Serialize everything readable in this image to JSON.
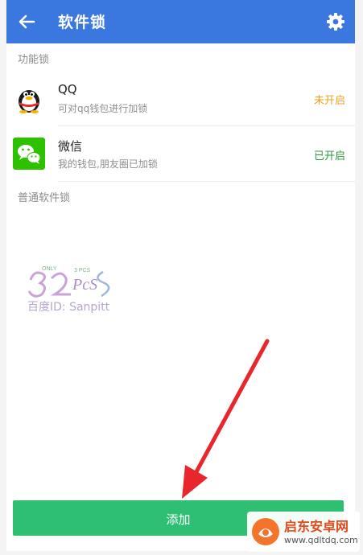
{
  "header": {
    "title": "软件锁",
    "back_icon": "arrow-left-icon",
    "settings_icon": "gear-icon",
    "color": "#3a78e0"
  },
  "sections": {
    "function_lock": "功能锁",
    "normal_lock": "普通软件锁"
  },
  "apps": [
    {
      "name": "QQ",
      "desc": "可对qq钱包进行加锁",
      "status": "未开启",
      "status_color": "#f0a020",
      "icon": "qq-penguin-icon"
    },
    {
      "name": "微信",
      "desc": "我的钱包,朋友圈已加锁",
      "status": "已开启",
      "status_color": "#2a9a3a",
      "icon": "wechat-icon"
    }
  ],
  "watermark": {
    "text": "百度ID: Sanpitt"
  },
  "add_button": {
    "label": "添加",
    "color": "#2ebf72"
  },
  "brand": {
    "name": "启东安卓网",
    "url": "www.qdltdq.com"
  }
}
